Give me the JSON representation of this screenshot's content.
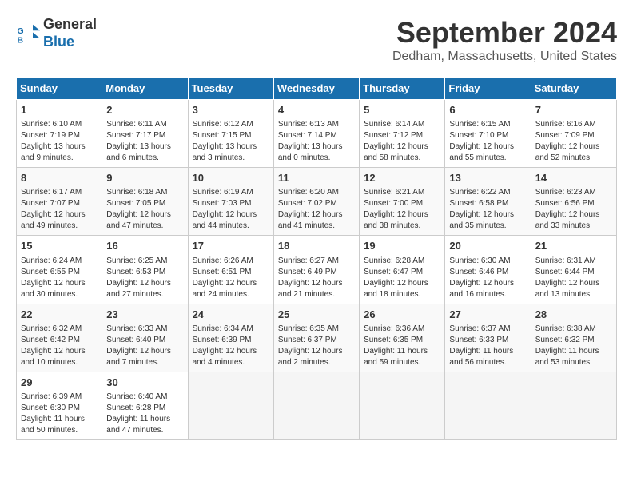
{
  "header": {
    "logo_line1": "General",
    "logo_line2": "Blue",
    "month_title": "September 2024",
    "location": "Dedham, Massachusetts, United States"
  },
  "weekdays": [
    "Sunday",
    "Monday",
    "Tuesday",
    "Wednesday",
    "Thursday",
    "Friday",
    "Saturday"
  ],
  "weeks": [
    [
      {
        "day": "1",
        "info": "Sunrise: 6:10 AM\nSunset: 7:19 PM\nDaylight: 13 hours\nand 9 minutes."
      },
      {
        "day": "2",
        "info": "Sunrise: 6:11 AM\nSunset: 7:17 PM\nDaylight: 13 hours\nand 6 minutes."
      },
      {
        "day": "3",
        "info": "Sunrise: 6:12 AM\nSunset: 7:15 PM\nDaylight: 13 hours\nand 3 minutes."
      },
      {
        "day": "4",
        "info": "Sunrise: 6:13 AM\nSunset: 7:14 PM\nDaylight: 13 hours\nand 0 minutes."
      },
      {
        "day": "5",
        "info": "Sunrise: 6:14 AM\nSunset: 7:12 PM\nDaylight: 12 hours\nand 58 minutes."
      },
      {
        "day": "6",
        "info": "Sunrise: 6:15 AM\nSunset: 7:10 PM\nDaylight: 12 hours\nand 55 minutes."
      },
      {
        "day": "7",
        "info": "Sunrise: 6:16 AM\nSunset: 7:09 PM\nDaylight: 12 hours\nand 52 minutes."
      }
    ],
    [
      {
        "day": "8",
        "info": "Sunrise: 6:17 AM\nSunset: 7:07 PM\nDaylight: 12 hours\nand 49 minutes."
      },
      {
        "day": "9",
        "info": "Sunrise: 6:18 AM\nSunset: 7:05 PM\nDaylight: 12 hours\nand 47 minutes."
      },
      {
        "day": "10",
        "info": "Sunrise: 6:19 AM\nSunset: 7:03 PM\nDaylight: 12 hours\nand 44 minutes."
      },
      {
        "day": "11",
        "info": "Sunrise: 6:20 AM\nSunset: 7:02 PM\nDaylight: 12 hours\nand 41 minutes."
      },
      {
        "day": "12",
        "info": "Sunrise: 6:21 AM\nSunset: 7:00 PM\nDaylight: 12 hours\nand 38 minutes."
      },
      {
        "day": "13",
        "info": "Sunrise: 6:22 AM\nSunset: 6:58 PM\nDaylight: 12 hours\nand 35 minutes."
      },
      {
        "day": "14",
        "info": "Sunrise: 6:23 AM\nSunset: 6:56 PM\nDaylight: 12 hours\nand 33 minutes."
      }
    ],
    [
      {
        "day": "15",
        "info": "Sunrise: 6:24 AM\nSunset: 6:55 PM\nDaylight: 12 hours\nand 30 minutes."
      },
      {
        "day": "16",
        "info": "Sunrise: 6:25 AM\nSunset: 6:53 PM\nDaylight: 12 hours\nand 27 minutes."
      },
      {
        "day": "17",
        "info": "Sunrise: 6:26 AM\nSunset: 6:51 PM\nDaylight: 12 hours\nand 24 minutes."
      },
      {
        "day": "18",
        "info": "Sunrise: 6:27 AM\nSunset: 6:49 PM\nDaylight: 12 hours\nand 21 minutes."
      },
      {
        "day": "19",
        "info": "Sunrise: 6:28 AM\nSunset: 6:47 PM\nDaylight: 12 hours\nand 18 minutes."
      },
      {
        "day": "20",
        "info": "Sunrise: 6:30 AM\nSunset: 6:46 PM\nDaylight: 12 hours\nand 16 minutes."
      },
      {
        "day": "21",
        "info": "Sunrise: 6:31 AM\nSunset: 6:44 PM\nDaylight: 12 hours\nand 13 minutes."
      }
    ],
    [
      {
        "day": "22",
        "info": "Sunrise: 6:32 AM\nSunset: 6:42 PM\nDaylight: 12 hours\nand 10 minutes."
      },
      {
        "day": "23",
        "info": "Sunrise: 6:33 AM\nSunset: 6:40 PM\nDaylight: 12 hours\nand 7 minutes."
      },
      {
        "day": "24",
        "info": "Sunrise: 6:34 AM\nSunset: 6:39 PM\nDaylight: 12 hours\nand 4 minutes."
      },
      {
        "day": "25",
        "info": "Sunrise: 6:35 AM\nSunset: 6:37 PM\nDaylight: 12 hours\nand 2 minutes."
      },
      {
        "day": "26",
        "info": "Sunrise: 6:36 AM\nSunset: 6:35 PM\nDaylight: 11 hours\nand 59 minutes."
      },
      {
        "day": "27",
        "info": "Sunrise: 6:37 AM\nSunset: 6:33 PM\nDaylight: 11 hours\nand 56 minutes."
      },
      {
        "day": "28",
        "info": "Sunrise: 6:38 AM\nSunset: 6:32 PM\nDaylight: 11 hours\nand 53 minutes."
      }
    ],
    [
      {
        "day": "29",
        "info": "Sunrise: 6:39 AM\nSunset: 6:30 PM\nDaylight: 11 hours\nand 50 minutes."
      },
      {
        "day": "30",
        "info": "Sunrise: 6:40 AM\nSunset: 6:28 PM\nDaylight: 11 hours\nand 47 minutes."
      },
      null,
      null,
      null,
      null,
      null
    ]
  ]
}
